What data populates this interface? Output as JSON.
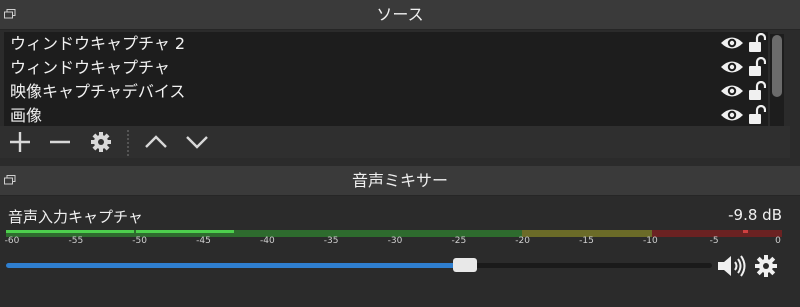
{
  "sources": {
    "title": "ソース",
    "items": [
      {
        "label": "ウィンドウキャプチャ 2",
        "visible": true,
        "locked": false
      },
      {
        "label": "ウィンドウキャプチャ",
        "visible": true,
        "locked": false
      },
      {
        "label": "映像キャプチャデバイス",
        "visible": true,
        "locked": false
      },
      {
        "label": "画像",
        "visible": true,
        "locked": false
      }
    ],
    "toolbar": [
      "add-icon",
      "remove-icon",
      "gear-icon",
      "chevron-up-icon",
      "chevron-down-icon"
    ]
  },
  "mixer": {
    "title": "音声ミキサー",
    "channel": {
      "name": "音声入力キャプチャ",
      "db": "-9.8 dB",
      "ticks": [
        "-60",
        "-55",
        "-50",
        "-45",
        "-40",
        "-35",
        "-30",
        "-25",
        "-20",
        "-15",
        "-10",
        "-5",
        "0"
      ],
      "volume_fraction": 0.65
    },
    "icons": [
      "speaker-icon",
      "gear-icon"
    ]
  },
  "colors": {
    "green": "#4dd04d",
    "green_dim": "#2e6b2e",
    "yellow": "#a0a030",
    "red": "#b03030",
    "accent_blue": "#2f7fd0"
  }
}
